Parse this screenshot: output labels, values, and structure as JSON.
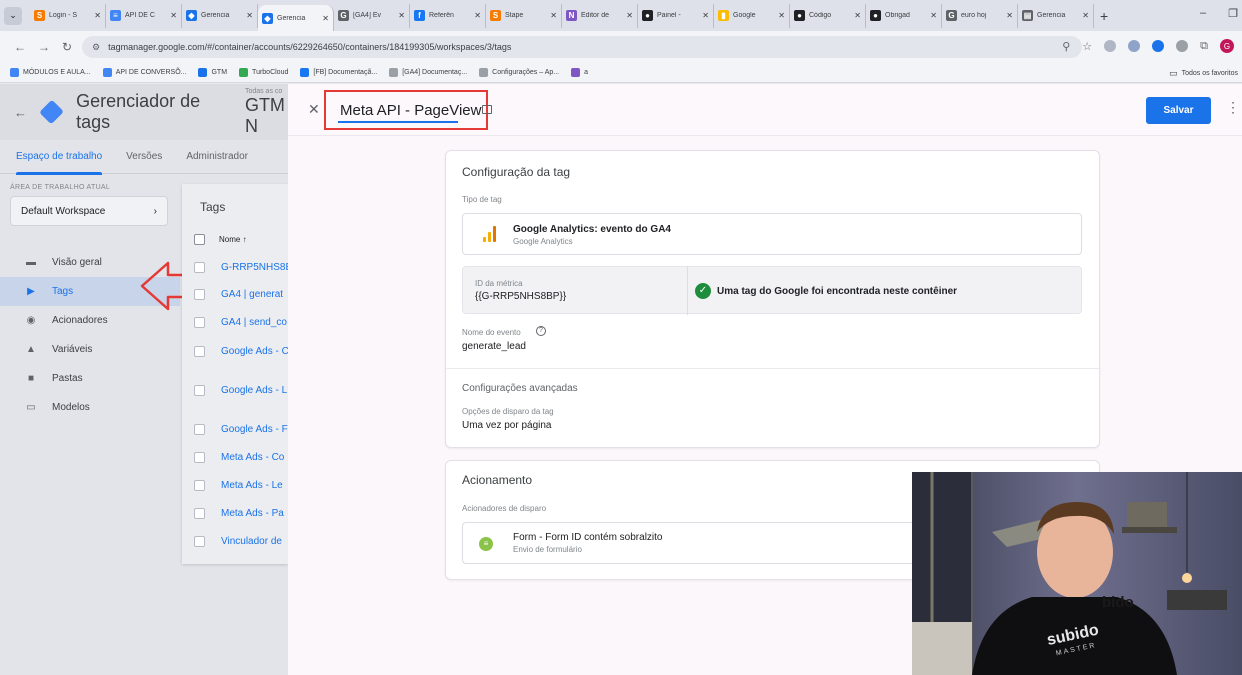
{
  "browser": {
    "tabs": [
      {
        "label": "Login - S",
        "icon_color": "#f57c00",
        "icon": "S"
      },
      {
        "label": "API DE C",
        "icon_color": "#4285f4",
        "icon": "≡"
      },
      {
        "label": "Gerencia",
        "icon_color": "#1a73e8",
        "icon": "◆"
      },
      {
        "label": "Gerencia",
        "icon_color": "#1a73e8",
        "icon": "◆",
        "active": true
      },
      {
        "label": "[GA4] Ev",
        "icon_color": "#5f6368",
        "icon": "G"
      },
      {
        "label": "Referên",
        "icon_color": "#1877f2",
        "icon": "f"
      },
      {
        "label": "Stape",
        "icon_color": "#f57c00",
        "icon": "S"
      },
      {
        "label": "Editor de",
        "icon_color": "#7e57c2",
        "icon": "N"
      },
      {
        "label": "Painel - ",
        "icon_color": "#202124",
        "icon": "●"
      },
      {
        "label": "Google",
        "icon_color": "#fbbc04",
        "icon": "▮"
      },
      {
        "label": "Código",
        "icon_color": "#202124",
        "icon": "●"
      },
      {
        "label": "Obrigad",
        "icon_color": "#202124",
        "icon": "●"
      },
      {
        "label": "euro hoj",
        "icon_color": "#5f6368",
        "icon": "G"
      },
      {
        "label": "Gerencia",
        "icon_color": "#5f6368",
        "icon": "▤"
      }
    ],
    "url": "tagmanager.google.com/#/container/accounts/6229264650/containers/184199305/workspaces/3/tags",
    "bookmarks": [
      {
        "label": "MÓDULOS E AULA...",
        "color": "#4285f4"
      },
      {
        "label": "API DE CONVERSÕ...",
        "color": "#4285f4"
      },
      {
        "label": "GTM",
        "color": "#1a73e8"
      },
      {
        "label": "TurboCloud",
        "color": "#34a853"
      },
      {
        "label": "[FB] Documentaçã...",
        "color": "#1877f2"
      },
      {
        "label": "[GA4] Documentaç...",
        "color": "#9aa0a6"
      },
      {
        "label": "Configurações – Ap...",
        "color": "#9aa0a6"
      },
      {
        "label": "a",
        "color": "#7e57c2"
      }
    ],
    "bookmarks_right": "Todos os favoritos",
    "profile_initial": "G"
  },
  "gtm": {
    "app_title": "Gerenciador de tags",
    "account_small": "Todas as co",
    "account_big": "GTM N",
    "nav_tabs": [
      "Espaço de trabalho",
      "Versões",
      "Administrador"
    ],
    "workspace_label": "ÁREA DE TRABALHO ATUAL",
    "workspace_value": "Default Workspace",
    "sidenav": [
      {
        "label": "Visão geral",
        "icon": "overview-icon",
        "glyph": "▬"
      },
      {
        "label": "Tags",
        "icon": "tag-icon",
        "glyph": "▶",
        "selected": true
      },
      {
        "label": "Acionadores",
        "icon": "trigger-icon",
        "glyph": "◉"
      },
      {
        "label": "Variáveis",
        "icon": "variables-icon",
        "glyph": "▲"
      },
      {
        "label": "Pastas",
        "icon": "folder-icon",
        "glyph": "■"
      },
      {
        "label": "Modelos",
        "icon": "template-icon",
        "glyph": "▭"
      }
    ],
    "tags_panel": {
      "title": "Tags",
      "column": "Nome ↑",
      "rows": [
        "G-RRP5NHS8E",
        "GA4 | generat",
        "GA4 | send_co",
        "Google Ads - C",
        "Google Ads - L",
        "Google Ads - F",
        "Meta Ads - Co",
        "Meta Ads - Le",
        "Meta Ads - Pa",
        "Vinculador de"
      ]
    }
  },
  "editor": {
    "tag_name": "Meta API - PageView",
    "save_label": "Salvar",
    "config_card": {
      "title": "Configuração da tag",
      "type_label": "Tipo de tag",
      "type_name": "Google Analytics: evento do GA4",
      "type_sub": "Google Analytics",
      "metric_label": "ID da métrica",
      "metric_value": "{{G-RRP5NHS8BP}}",
      "found_text": "Uma tag do Google foi encontrada neste contêiner",
      "event_label": "Nome do evento",
      "event_value": "generate_lead",
      "advanced_title": "Configurações avançadas",
      "firing_label": "Opções de disparo da tag",
      "firing_value": "Uma vez por página"
    },
    "trigger_card": {
      "title": "Acionamento",
      "label": "Acionadores de disparo",
      "trigger_name": "Form - Form ID contém sobralzito",
      "trigger_sub": "Envio de formulário"
    }
  },
  "webcam": {
    "shirt_text_1": "subido",
    "shirt_text_2": "MASTER",
    "wall_text": "bido"
  },
  "colors": {
    "accent": "#1a73e8",
    "highlight": "#e53935",
    "success": "#1e8e3e"
  }
}
